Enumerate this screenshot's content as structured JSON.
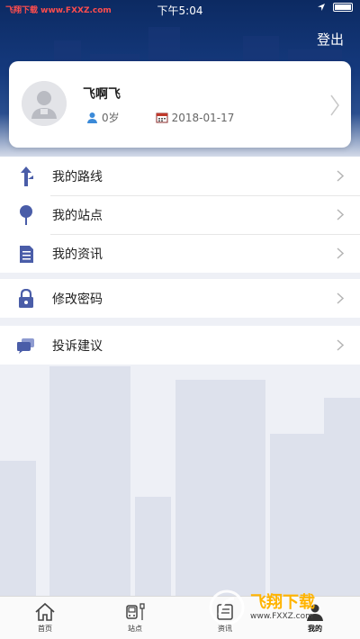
{
  "status_bar": {
    "carrier": "飞翔下载 www.FXXZ.com",
    "time": "下午5:04"
  },
  "header": {
    "logout_label": "登出"
  },
  "profile": {
    "name": "飞啊飞",
    "age": "0岁",
    "date": "2018-01-17"
  },
  "menu": {
    "group1": [
      {
        "label": "我的路线",
        "icon": "route-icon"
      },
      {
        "label": "我的站点",
        "icon": "pin-icon"
      },
      {
        "label": "我的资讯",
        "icon": "document-icon"
      }
    ],
    "group2": [
      {
        "label": "修改密码",
        "icon": "lock-icon"
      }
    ],
    "group3": [
      {
        "label": "投诉建议",
        "icon": "chat-bubble-icon"
      }
    ]
  },
  "tabs": [
    {
      "label": "首页",
      "icon": "home-icon"
    },
    {
      "label": "站点",
      "icon": "bus-stop-icon"
    },
    {
      "label": "资讯",
      "icon": "news-icon"
    },
    {
      "label": "我的",
      "icon": "user-icon",
      "active": true
    }
  ],
  "watermark": {
    "title": "飞翔下载",
    "url": "www.FXXZ.com"
  },
  "colors": {
    "header_dark": "#0c2a62",
    "icon_blue": "#4a5da8",
    "accent_yellow": "#ffb400"
  }
}
